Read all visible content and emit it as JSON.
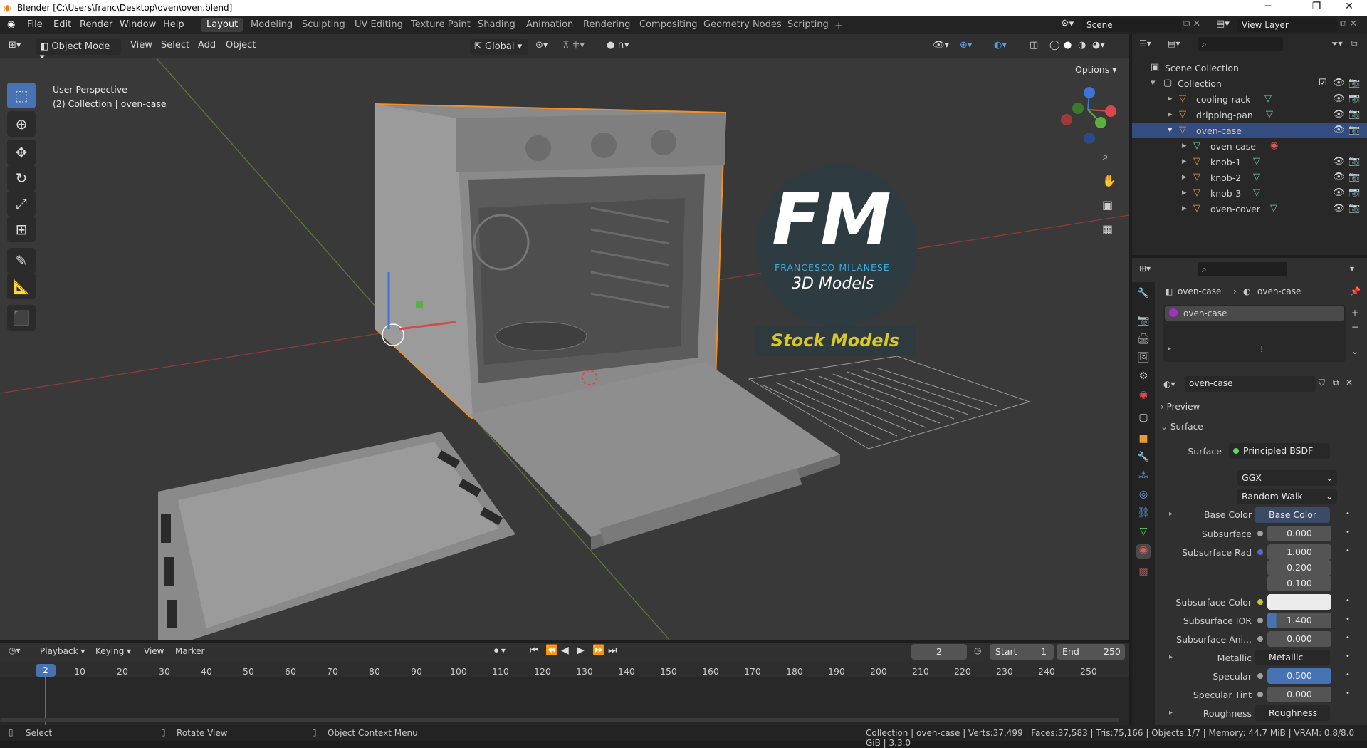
{
  "window": {
    "title": "Blender [C:\\Users\\franc\\Desktop\\oven\\oven.blend]",
    "minimize": "─",
    "maximize": "❐",
    "close": "✕"
  },
  "menu": [
    "File",
    "Edit",
    "Render",
    "Window",
    "Help"
  ],
  "workspaces": [
    "Layout",
    "Modeling",
    "Sculpting",
    "UV Editing",
    "Texture Paint",
    "Shading",
    "Animation",
    "Rendering",
    "Compositing",
    "Geometry Nodes",
    "Scripting"
  ],
  "add_workspace": "+",
  "scene": {
    "name": "Scene",
    "view_layer": "View Layer"
  },
  "viewport_header": {
    "mode": "Object Mode",
    "menus": [
      "View",
      "Select",
      "Add",
      "Object"
    ],
    "orientation": "Global",
    "options": "Options"
  },
  "viewport": {
    "perspective": "User Perspective",
    "collection_info": "(2) Collection | oven-case",
    "watermark_letters": "FM",
    "watermark_name": "FRANCESCO MILANESE",
    "watermark_sub": "3D Models",
    "watermark_banner": "Stock Models"
  },
  "tools": [
    "select-box",
    "cursor",
    "move",
    "rotate",
    "scale",
    "transform",
    "annotate",
    "measure",
    "add-cube"
  ],
  "outliner": {
    "root": "Scene Collection",
    "collection": "Collection",
    "items": [
      {
        "label": "cooling-rack",
        "level": 1,
        "selected": false
      },
      {
        "label": "dripping-pan",
        "level": 1,
        "selected": false
      },
      {
        "label": "oven-case",
        "level": 1,
        "selected": true
      },
      {
        "label": "oven-case",
        "level": 2,
        "selected": false,
        "mesh": true
      },
      {
        "label": "knob-1",
        "level": 2,
        "selected": false
      },
      {
        "label": "knob-2",
        "level": 2,
        "selected": false
      },
      {
        "label": "knob-3",
        "level": 2,
        "selected": false
      },
      {
        "label": "oven-cover",
        "level": 2,
        "selected": false
      }
    ]
  },
  "properties": {
    "breadcrumb_object": "oven-case",
    "breadcrumb_material": "oven-case",
    "material_slot": "oven-case",
    "material_name": "oven-case",
    "panel_preview": "Preview",
    "panel_surface": "Surface",
    "surface_label": "Surface",
    "surface_shader": "Principled BSDF",
    "distribution": "GGX",
    "subsurface_method": "Random Walk",
    "rows": [
      {
        "label": "Base Color",
        "value": "Base Color",
        "kind": "link",
        "dot": "#c7c729",
        "expand": true
      },
      {
        "label": "Subsurface",
        "value": "0.000",
        "kind": "num",
        "dot": "#a1a1a1"
      },
      {
        "label": "Subsurface Rad",
        "value": "1.000",
        "kind": "num",
        "dot": "#6363c7"
      },
      {
        "label": "",
        "value": "0.200",
        "kind": "num",
        "dot": ""
      },
      {
        "label": "",
        "value": "0.100",
        "kind": "num",
        "dot": ""
      },
      {
        "label": "Subsurface Color",
        "value": "",
        "kind": "color",
        "dot": "#c7c729"
      },
      {
        "label": "Subsurface IOR",
        "value": "1.400",
        "kind": "numbar",
        "dot": "#a1a1a1"
      },
      {
        "label": "Subsurface Ani...",
        "value": "0.000",
        "kind": "num",
        "dot": "#a1a1a1"
      },
      {
        "label": "Metallic",
        "value": "Metallic",
        "kind": "link",
        "dot": "#a1a1a1",
        "expand": true
      },
      {
        "label": "Specular",
        "value": "0.500",
        "kind": "fullbar",
        "dot": "#a1a1a1"
      },
      {
        "label": "Specular Tint",
        "value": "0.000",
        "kind": "num",
        "dot": "#a1a1a1"
      },
      {
        "label": "Roughness",
        "value": "Roughness",
        "kind": "link",
        "dot": "#a1a1a1",
        "expand": true
      }
    ]
  },
  "timeline": {
    "menus": [
      "Playback",
      "Keying",
      "View",
      "Marker"
    ],
    "current_frame": "2",
    "start_label": "Start",
    "start": "1",
    "end_label": "End",
    "end": "250",
    "ticks": [
      "2",
      "10",
      "20",
      "30",
      "40",
      "50",
      "60",
      "70",
      "80",
      "90",
      "100",
      "110",
      "120",
      "130",
      "140",
      "150",
      "160",
      "170",
      "180",
      "190",
      "200",
      "210",
      "220",
      "230",
      "240",
      "250"
    ]
  },
  "status": {
    "select": "Select",
    "rotate": "Rotate View",
    "context": "Object Context Menu",
    "stats": "Collection | oven-case | Verts:37,499 | Faces:37,583 | Tris:75,166 | Objects:1/7 | Memory: 44.7 MiB | VRAM: 0.8/8.0 GiB | 3.3.0"
  },
  "colors": {
    "accent": "#4772b3",
    "selection": "#e69a3a",
    "bg": "#393939"
  }
}
